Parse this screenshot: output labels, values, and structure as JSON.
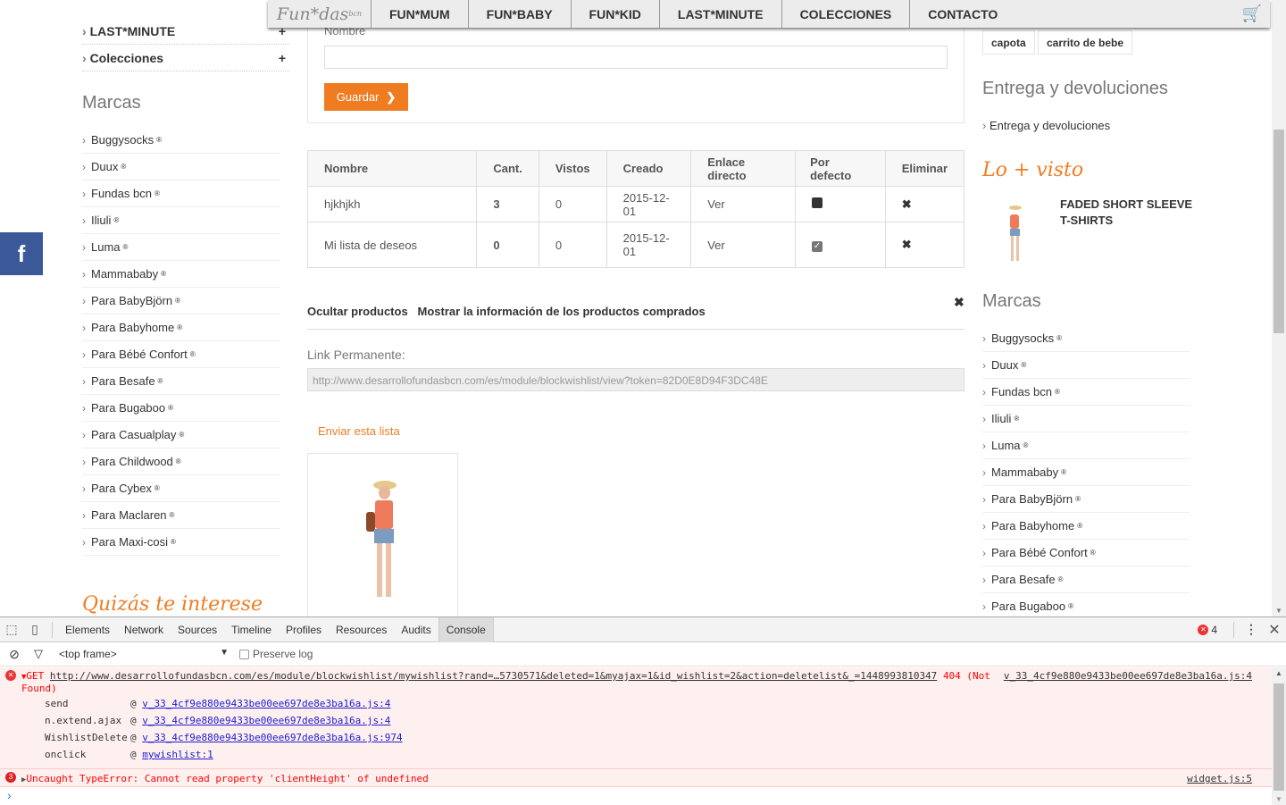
{
  "nav": {
    "logo": "Fun*das",
    "logo_sup": "bcn",
    "items": [
      "FUN*MUM",
      "FUN*BABY",
      "FUN*KID",
      "LAST*MINUTE",
      "COLECCIONES",
      "CONTACTO"
    ]
  },
  "left": {
    "cats": [
      {
        "label": "LAST*MINUTE",
        "toggle": "+"
      },
      {
        "label": "Colecciones",
        "toggle": "+"
      }
    ],
    "brands_title": "Marcas",
    "brands": [
      "Buggysocks",
      "Duux",
      "Fundas bcn",
      "Iliuli",
      "Luma",
      "Mammababy",
      "Para BabyBjörn",
      "Para Babyhome",
      "Para Bébé Confort",
      "Para Besafe",
      "Para Bugaboo",
      "Para Casualplay",
      "Para Childwood",
      "Para Cybex",
      "Para Maclaren",
      "Para Maxi-cosi"
    ],
    "reg": "®",
    "quizas": "Quizás te interese"
  },
  "social": {
    "facebook": "f"
  },
  "form": {
    "name_label": "Nombre",
    "name_value": "",
    "save": "Guardar"
  },
  "table": {
    "headers": [
      "Nombre",
      "Cant.",
      "Vistos",
      "Creado",
      "Enlace directo",
      "Por defecto",
      "Eliminar"
    ],
    "rows": [
      {
        "name": "hjkhjkh",
        "qty": "3",
        "viewed": "0",
        "created": "2015-12-01",
        "link": "Ver",
        "default": false
      },
      {
        "name": "Mi lista de deseos",
        "qty": "0",
        "viewed": "0",
        "created": "2015-12-01",
        "link": "Ver",
        "default": true
      }
    ]
  },
  "wishlist": {
    "hide": "Ocultar productos",
    "show_info": "Mostrar la información de los productos comprados",
    "permalink_label": "Link Permanente:",
    "permalink": "http://www.desarrollofundasbcn.com/es/module/blockwishlist/view?token=82D0E8D94F3DC48E",
    "send": "Enviar esta lista"
  },
  "right": {
    "tags": [
      "capota",
      "carrito de bebe"
    ],
    "delivery_title": "Entrega y devoluciones",
    "delivery_link": "Entrega y devoluciones",
    "most_viewed": "Lo + visto",
    "product": "FADED SHORT SLEEVE T-SHIRTS",
    "brands_title": "Marcas",
    "brands": [
      "Buggysocks",
      "Duux",
      "Fundas bcn",
      "Iliuli",
      "Luma",
      "Mammababy",
      "Para BabyBjörn",
      "Para Babyhome",
      "Para Bébé Confort",
      "Para Besafe",
      "Para Bugaboo"
    ]
  },
  "devtools": {
    "tabs": [
      "Elements",
      "Network",
      "Sources",
      "Timeline",
      "Profiles",
      "Resources",
      "Audits",
      "Console"
    ],
    "active_tab": "Console",
    "error_count": "4",
    "frame": "<top frame>",
    "preserve_log": "Preserve log",
    "err1": {
      "method": "GET",
      "url": "http://www.desarrollofundasbcn.com/es/module/blockwishlist/mywishlist?rand=…5730571&deleted=1&myajax=1&id_wishlist=2&action=deletelist&_=1448993810347",
      "status": "404 (Not",
      "status2": "Found)",
      "source": "v_33_4cf9e880e9433be00ee697de8e3ba16a.js:4",
      "stack": [
        {
          "fn": "send",
          "src": "v_33_4cf9e880e9433be00ee697de8e3ba16a.js:4"
        },
        {
          "fn": "n.extend.ajax",
          "src": "v_33_4cf9e880e9433be00ee697de8e3ba16a.js:4"
        },
        {
          "fn": "WishlistDelete",
          "src": "v_33_4cf9e880e9433be00ee697de8e3ba16a.js:974"
        },
        {
          "fn": "onclick",
          "src": "mywishlist:1"
        }
      ]
    },
    "err2": {
      "count": "3",
      "message": "Uncaught TypeError: Cannot read property 'clientHeight' of undefined",
      "source": "widget.js:5"
    },
    "prompt": "›"
  }
}
